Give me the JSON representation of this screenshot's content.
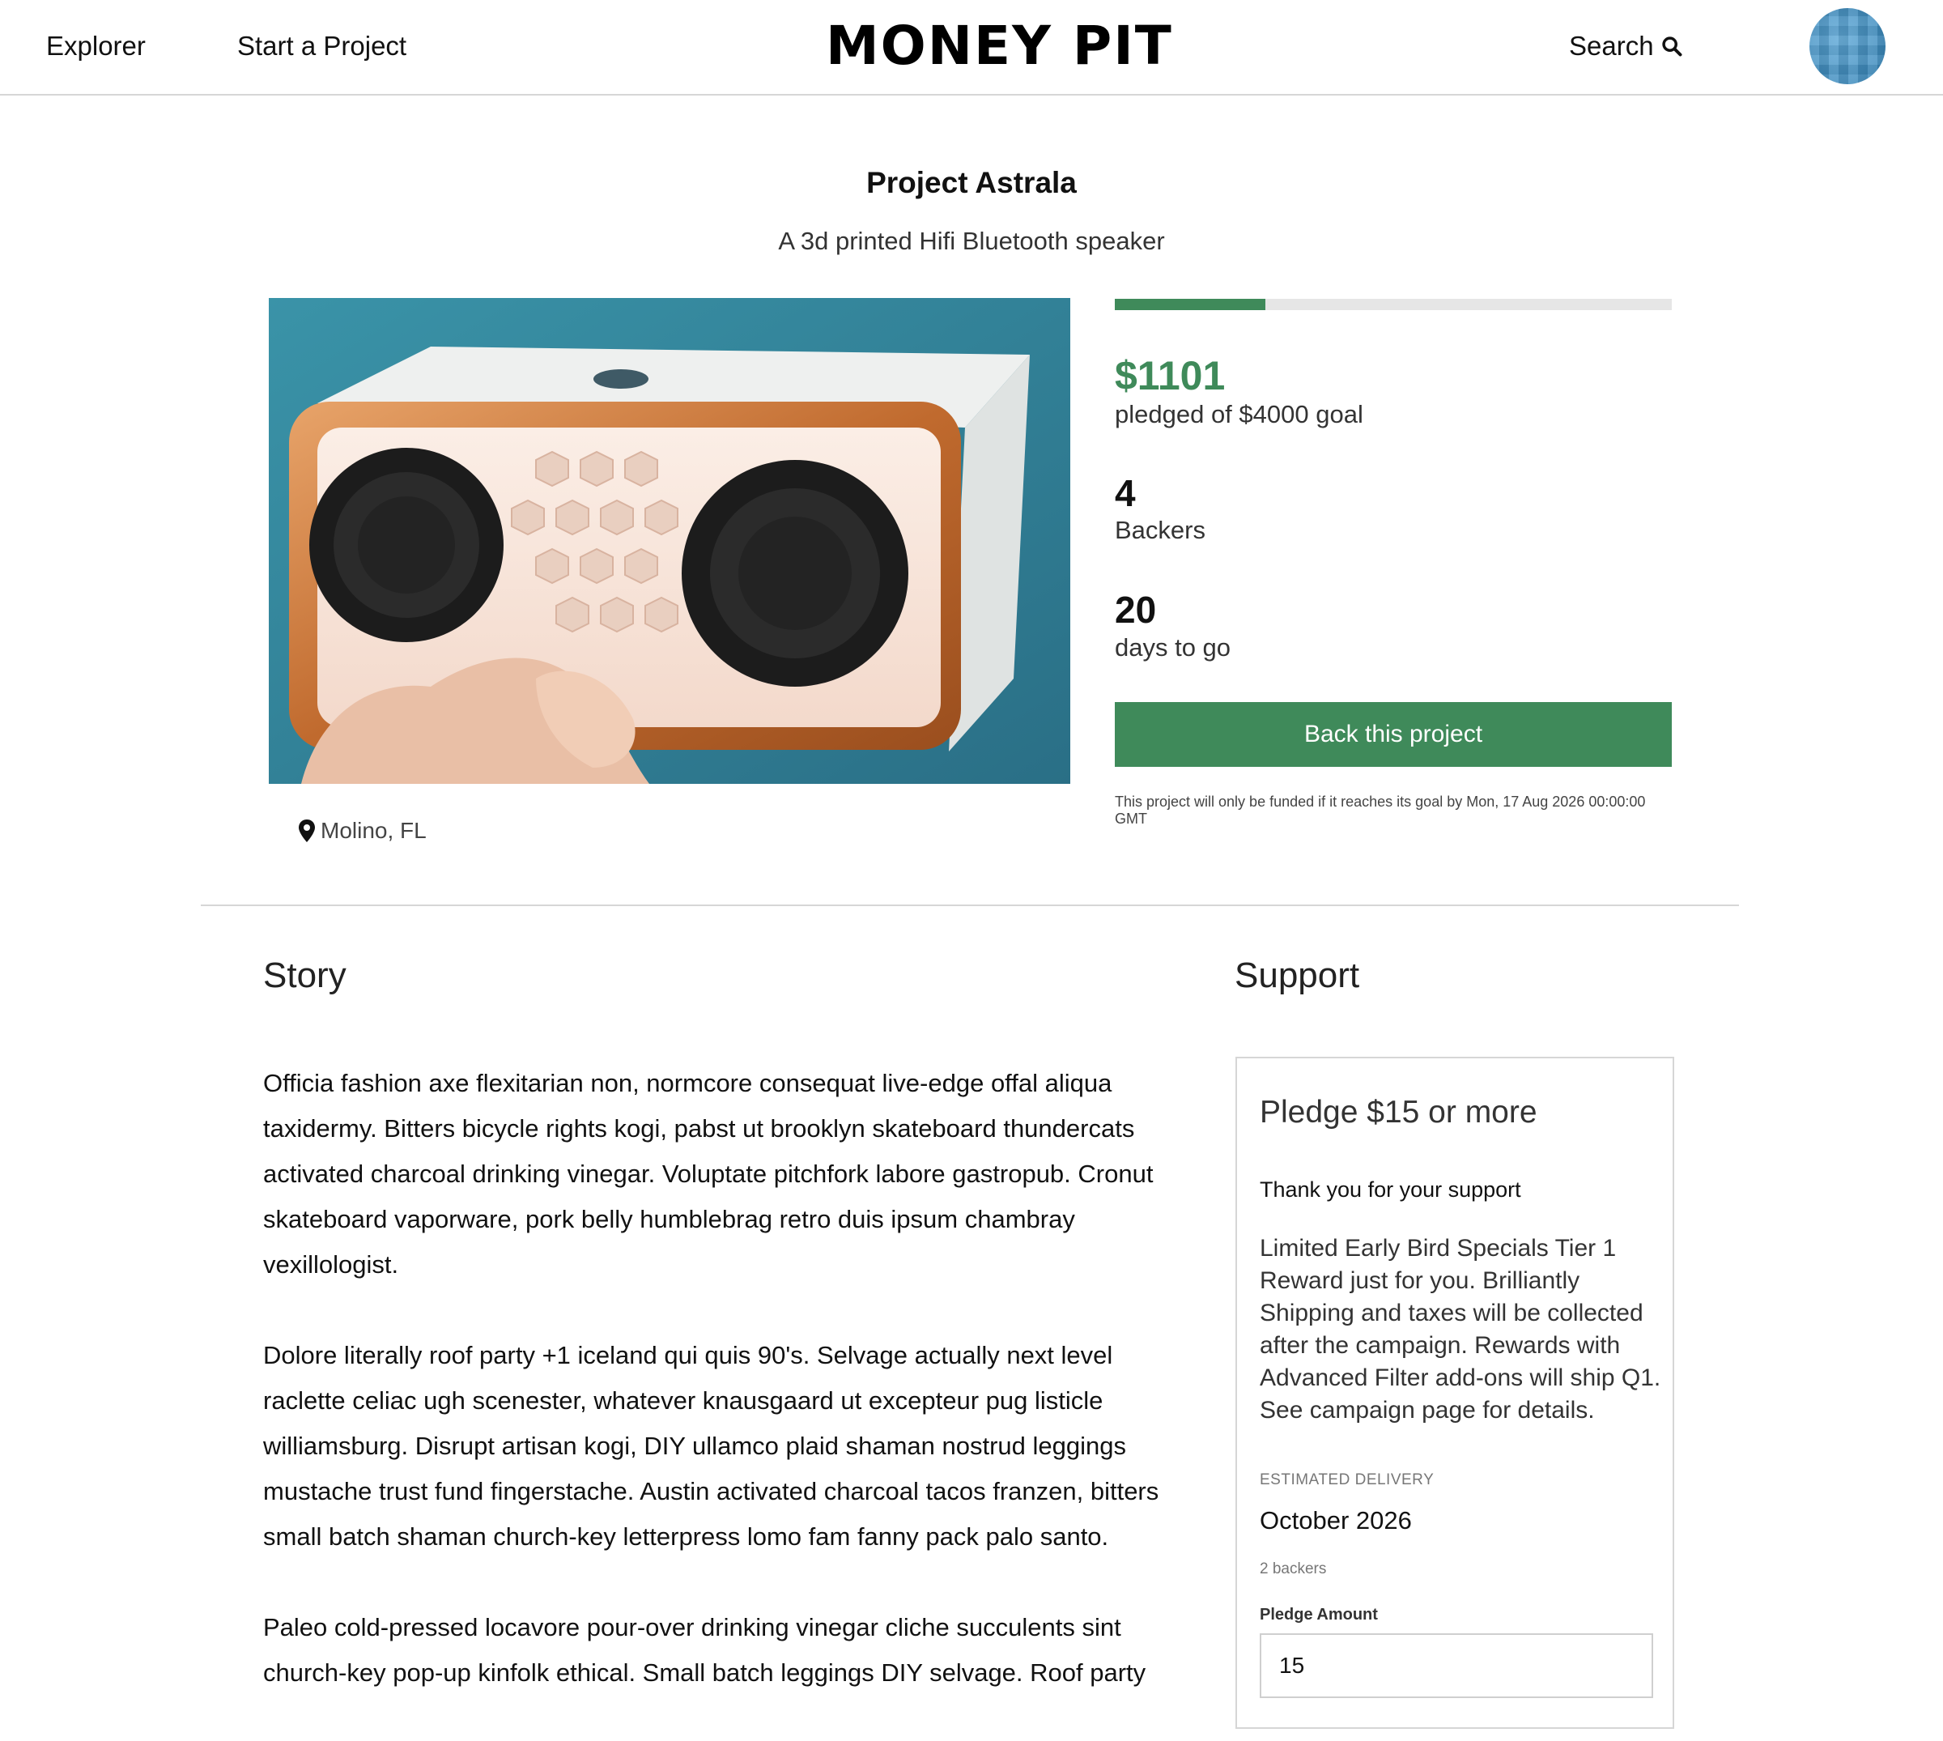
{
  "header": {
    "nav": [
      "Explorer",
      "Start a Project"
    ],
    "logo": "MONEY PIT",
    "search_label": "Search"
  },
  "project": {
    "title": "Project Astrala",
    "subtitle": "A 3d printed Hifi Bluetooth speaker",
    "location": "Molino, FL"
  },
  "stats": {
    "progress_fraction": 0.27,
    "pledged": "$1101",
    "pledged_label": "pledged of $4000 goal",
    "backers": "4",
    "backers_label": "Backers",
    "days": "20",
    "days_label": "days to go",
    "back_button": "Back this project",
    "fund_note": "This project will only be funded if it reaches its goal by Mon, 17 Aug 2026 00:00:00 GMT"
  },
  "story": {
    "heading": "Story",
    "paragraphs": [
      "Officia fashion axe flexitarian non, normcore consequat live-edge offal aliqua taxidermy. Bitters bicycle rights kogi, pabst ut brooklyn skateboard thundercats activated charcoal drinking vinegar. Voluptate pitchfork labore gastropub. Cronut skateboard vaporware, pork belly humblebrag retro duis ipsum chambray vexillologist.",
      "Dolore literally roof party +1 iceland qui quis 90's. Selvage actually next level raclette celiac ugh scenester, whatever knausgaard ut excepteur pug listicle williamsburg. Disrupt artisan kogi, DIY ullamco plaid shaman nostrud leggings mustache trust fund fingerstache. Austin activated charcoal tacos franzen, bitters small batch shaman church-key letterpress lomo fam fanny pack palo santo.",
      "Paleo cold-pressed locavore pour-over drinking vinegar cliche succulents sint church-key pop-up kinfolk ethical. Small batch leggings DIY selvage. Roof party"
    ]
  },
  "support": {
    "heading": "Support",
    "tier_title": "Pledge $15 or more",
    "thanks": "Thank you for your support",
    "description": "Limited Early Bird Specials Tier 1 Reward just for you. Brilliantly Shipping and taxes will be collected after the campaign. Rewards with Advanced Filter add-ons will ship Q1. See campaign page for details.",
    "est_label": "ESTIMATED DELIVERY",
    "est_value": "October 2026",
    "backers": "2 backers",
    "amount_label": "Pledge Amount",
    "amount_value": "15"
  },
  "colors": {
    "accent": "#3f8a5a",
    "divider": "#d6d6d6"
  }
}
